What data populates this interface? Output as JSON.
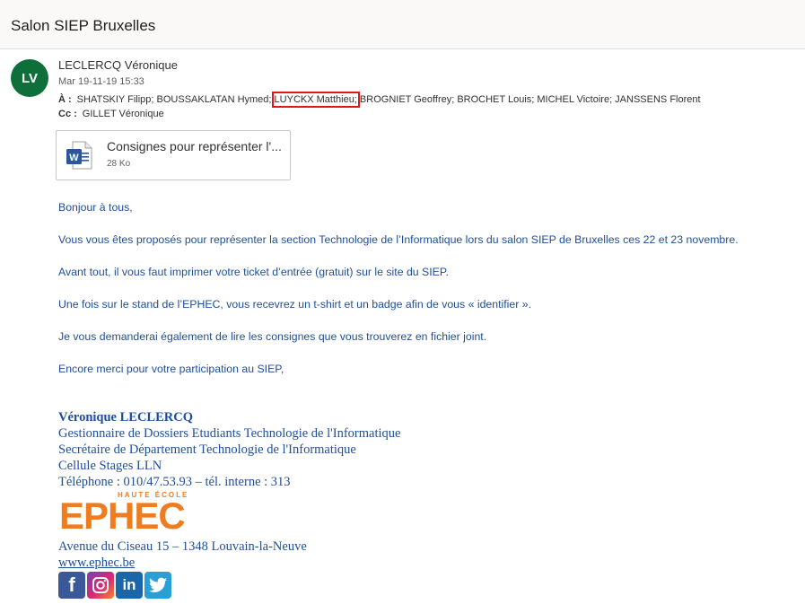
{
  "email": {
    "subject": "Salon SIEP Bruxelles",
    "sender": {
      "initials": "LV",
      "name": "LECLERCQ Véronique",
      "date": "Mar 19-11-19 15:33",
      "avatar_color": "#0e6f3b"
    },
    "to_label": "À :",
    "to_before": "SHATSKIY Filipp; BOUSSAKLATAN Hymed; ",
    "to_highlight": "LUYCKX Matthieu;",
    "to_after": " BROGNIET Geoffrey; BROCHET Louis; MICHEL Victoire; JANSSENS Florent",
    "cc_label": "Cc :",
    "cc": "GILLET Véronique",
    "highlight_color": "#e3141a"
  },
  "attachment": {
    "icon": "word-document-icon",
    "name": "Consignes pour représenter l'...",
    "size": "28 Ko"
  },
  "body": {
    "color": "#1f4e99",
    "paragraphs": [
      "Bonjour à tous,",
      "Vous vous êtes proposés pour représenter la section Technologie de l’Informatique lors du salon SIEP de Bruxelles ces 22 et 23 novembre.",
      "Avant tout, il vous faut imprimer votre ticket d’entrée (gratuit) sur le site du SIEP.",
      "Une fois sur le stand de l’EPHEC, vous recevrez un t-shirt et un badge afin de vous « identifier ».",
      "Je vous demanderai également de lire les consignes que vous trouverez en fichier joint.",
      "Encore merci pour votre participation au SIEP,"
    ]
  },
  "signature": {
    "name": "Véronique LECLERCQ",
    "lines": [
      "Gestionnaire de Dossiers Etudiants Technologie de l'Informatique",
      "Secrétaire de Département Technologie de l'Informatique",
      "Cellule Stages LLN",
      "Téléphone : 010/47.53.93 – tél. interne : 313"
    ],
    "logo_sub": "HAUTE ÉCOLE",
    "logo_main": "EPHEC",
    "logo_color": "#ee7d22",
    "address": "Avenue du Ciseau 15 – 1348 Louvain-la-Neuve",
    "website": "www.ephec.be",
    "social": [
      {
        "icon": "facebook-icon",
        "glyph": "f",
        "color": "#3b5998"
      },
      {
        "icon": "instagram-icon",
        "glyph": "",
        "color": "#d62976"
      },
      {
        "icon": "linkedin-icon",
        "glyph": "in",
        "color": "#1a66a8"
      },
      {
        "icon": "twitter-icon",
        "glyph": "",
        "color": "#2a9fd6"
      }
    ]
  }
}
